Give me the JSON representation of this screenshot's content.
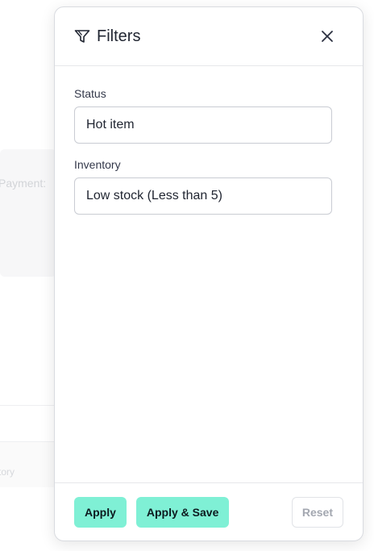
{
  "background": {
    "payment_label": "Payment:",
    "inventory_col": "tory"
  },
  "panel": {
    "title": "Filters",
    "fields": [
      {
        "label": "Status",
        "value": "Hot item"
      },
      {
        "label": "Inventory",
        "value": "Low stock (Less than 5)"
      }
    ],
    "footer": {
      "apply_label": "Apply",
      "apply_save_label": "Apply & Save",
      "reset_label": "Reset"
    }
  },
  "colors": {
    "accent": "#7ff0d5",
    "text": "#1f2430",
    "border": "#c9ccd3"
  },
  "icons": [
    "filter-icon",
    "close-icon"
  ]
}
